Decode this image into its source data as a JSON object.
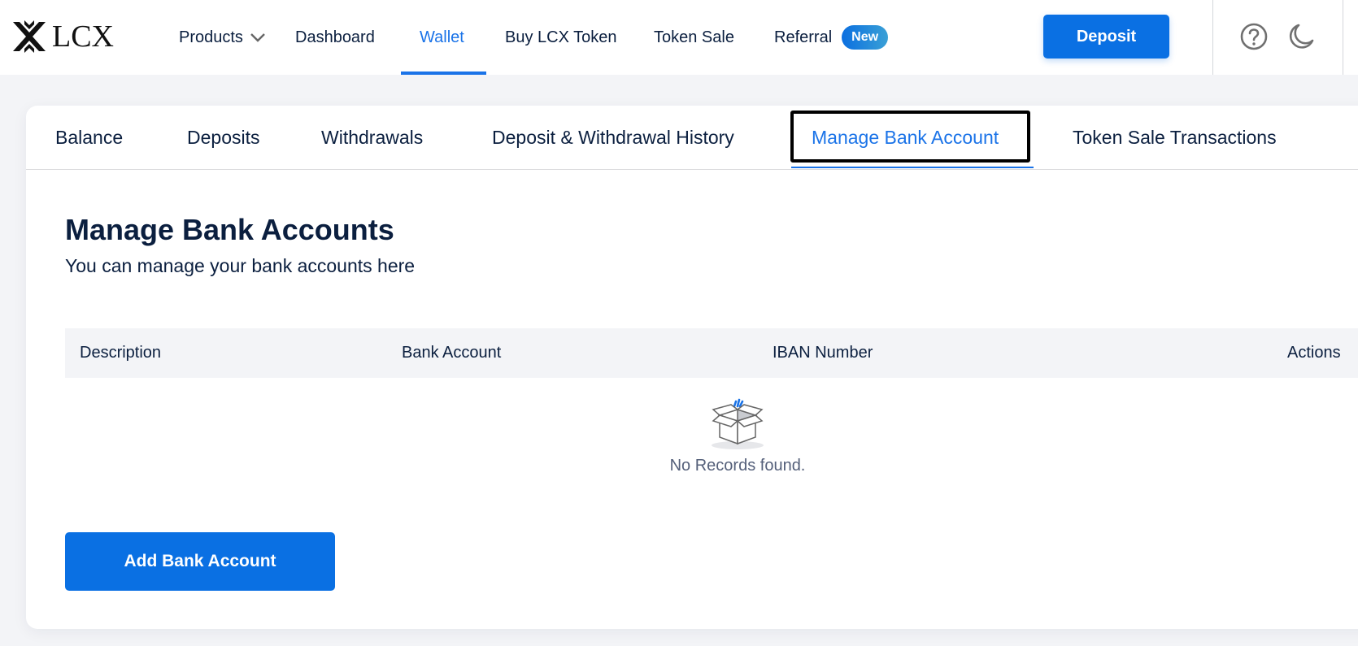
{
  "header": {
    "logo_text": "LCX",
    "nav": [
      {
        "label": "Products",
        "has_dropdown": true
      },
      {
        "label": "Dashboard"
      },
      {
        "label": "Wallet",
        "active": true
      },
      {
        "label": "Buy LCX Token"
      },
      {
        "label": "Token Sale"
      },
      {
        "label": "Referral",
        "badge": "New"
      }
    ],
    "deposit_label": "Deposit",
    "icons": [
      "help-icon",
      "dark-mode-moon-icon"
    ]
  },
  "tabs": [
    {
      "label": "Balance"
    },
    {
      "label": "Deposits"
    },
    {
      "label": "Withdrawals"
    },
    {
      "label": "Deposit & Withdrawal History"
    },
    {
      "label": "Manage Bank Account",
      "active": true
    },
    {
      "label": "Token Sale Transactions"
    }
  ],
  "main": {
    "title": "Manage Bank Accounts",
    "subtitle": "You can manage your bank accounts here",
    "table": {
      "columns": [
        "Description",
        "Bank Account",
        "IBAN Number",
        "Actions"
      ],
      "rows": [],
      "empty_text": "No Records found."
    },
    "add_button_label": "Add Bank Account"
  },
  "colors": {
    "accent": "#0a70e3",
    "active_link": "#1a73e8",
    "text_primary": "#0b1f3f",
    "background": "#f3f4f7"
  }
}
